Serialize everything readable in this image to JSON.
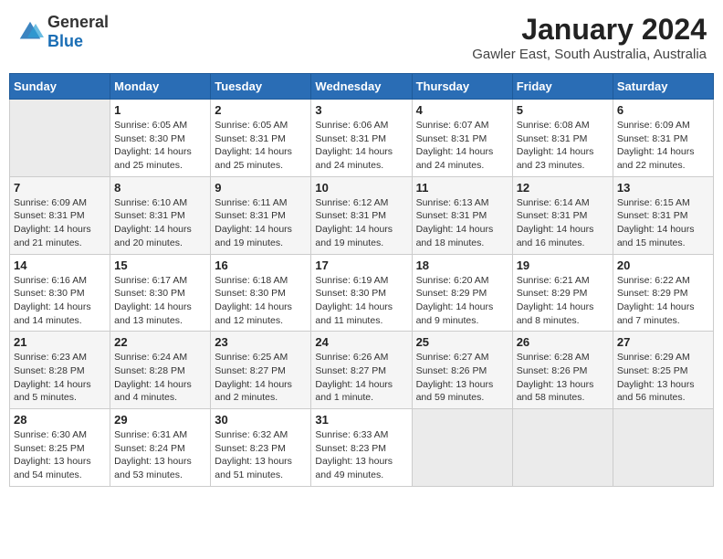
{
  "header": {
    "logo_general": "General",
    "logo_blue": "Blue",
    "month_year": "January 2024",
    "location": "Gawler East, South Australia, Australia"
  },
  "days_of_week": [
    "Sunday",
    "Monday",
    "Tuesday",
    "Wednesday",
    "Thursday",
    "Friday",
    "Saturday"
  ],
  "weeks": [
    [
      {
        "day": "",
        "empty": true
      },
      {
        "day": "1",
        "sunrise": "6:05 AM",
        "sunset": "8:30 PM",
        "daylight": "14 hours and 25 minutes."
      },
      {
        "day": "2",
        "sunrise": "6:05 AM",
        "sunset": "8:31 PM",
        "daylight": "14 hours and 25 minutes."
      },
      {
        "day": "3",
        "sunrise": "6:06 AM",
        "sunset": "8:31 PM",
        "daylight": "14 hours and 24 minutes."
      },
      {
        "day": "4",
        "sunrise": "6:07 AM",
        "sunset": "8:31 PM",
        "daylight": "14 hours and 24 minutes."
      },
      {
        "day": "5",
        "sunrise": "6:08 AM",
        "sunset": "8:31 PM",
        "daylight": "14 hours and 23 minutes."
      },
      {
        "day": "6",
        "sunrise": "6:09 AM",
        "sunset": "8:31 PM",
        "daylight": "14 hours and 22 minutes."
      }
    ],
    [
      {
        "day": "7",
        "sunrise": "6:09 AM",
        "sunset": "8:31 PM",
        "daylight": "14 hours and 21 minutes."
      },
      {
        "day": "8",
        "sunrise": "6:10 AM",
        "sunset": "8:31 PM",
        "daylight": "14 hours and 20 minutes."
      },
      {
        "day": "9",
        "sunrise": "6:11 AM",
        "sunset": "8:31 PM",
        "daylight": "14 hours and 19 minutes."
      },
      {
        "day": "10",
        "sunrise": "6:12 AM",
        "sunset": "8:31 PM",
        "daylight": "14 hours and 19 minutes."
      },
      {
        "day": "11",
        "sunrise": "6:13 AM",
        "sunset": "8:31 PM",
        "daylight": "14 hours and 18 minutes."
      },
      {
        "day": "12",
        "sunrise": "6:14 AM",
        "sunset": "8:31 PM",
        "daylight": "14 hours and 16 minutes."
      },
      {
        "day": "13",
        "sunrise": "6:15 AM",
        "sunset": "8:31 PM",
        "daylight": "14 hours and 15 minutes."
      }
    ],
    [
      {
        "day": "14",
        "sunrise": "6:16 AM",
        "sunset": "8:30 PM",
        "daylight": "14 hours and 14 minutes."
      },
      {
        "day": "15",
        "sunrise": "6:17 AM",
        "sunset": "8:30 PM",
        "daylight": "14 hours and 13 minutes."
      },
      {
        "day": "16",
        "sunrise": "6:18 AM",
        "sunset": "8:30 PM",
        "daylight": "14 hours and 12 minutes."
      },
      {
        "day": "17",
        "sunrise": "6:19 AM",
        "sunset": "8:30 PM",
        "daylight": "14 hours and 11 minutes."
      },
      {
        "day": "18",
        "sunrise": "6:20 AM",
        "sunset": "8:29 PM",
        "daylight": "14 hours and 9 minutes."
      },
      {
        "day": "19",
        "sunrise": "6:21 AM",
        "sunset": "8:29 PM",
        "daylight": "14 hours and 8 minutes."
      },
      {
        "day": "20",
        "sunrise": "6:22 AM",
        "sunset": "8:29 PM",
        "daylight": "14 hours and 7 minutes."
      }
    ],
    [
      {
        "day": "21",
        "sunrise": "6:23 AM",
        "sunset": "8:28 PM",
        "daylight": "14 hours and 5 minutes."
      },
      {
        "day": "22",
        "sunrise": "6:24 AM",
        "sunset": "8:28 PM",
        "daylight": "14 hours and 4 minutes."
      },
      {
        "day": "23",
        "sunrise": "6:25 AM",
        "sunset": "8:27 PM",
        "daylight": "14 hours and 2 minutes."
      },
      {
        "day": "24",
        "sunrise": "6:26 AM",
        "sunset": "8:27 PM",
        "daylight": "14 hours and 1 minute."
      },
      {
        "day": "25",
        "sunrise": "6:27 AM",
        "sunset": "8:26 PM",
        "daylight": "13 hours and 59 minutes."
      },
      {
        "day": "26",
        "sunrise": "6:28 AM",
        "sunset": "8:26 PM",
        "daylight": "13 hours and 58 minutes."
      },
      {
        "day": "27",
        "sunrise": "6:29 AM",
        "sunset": "8:25 PM",
        "daylight": "13 hours and 56 minutes."
      }
    ],
    [
      {
        "day": "28",
        "sunrise": "6:30 AM",
        "sunset": "8:25 PM",
        "daylight": "13 hours and 54 minutes."
      },
      {
        "day": "29",
        "sunrise": "6:31 AM",
        "sunset": "8:24 PM",
        "daylight": "13 hours and 53 minutes."
      },
      {
        "day": "30",
        "sunrise": "6:32 AM",
        "sunset": "8:23 PM",
        "daylight": "13 hours and 51 minutes."
      },
      {
        "day": "31",
        "sunrise": "6:33 AM",
        "sunset": "8:23 PM",
        "daylight": "13 hours and 49 minutes."
      },
      {
        "day": "",
        "empty": true
      },
      {
        "day": "",
        "empty": true
      },
      {
        "day": "",
        "empty": true
      }
    ]
  ]
}
